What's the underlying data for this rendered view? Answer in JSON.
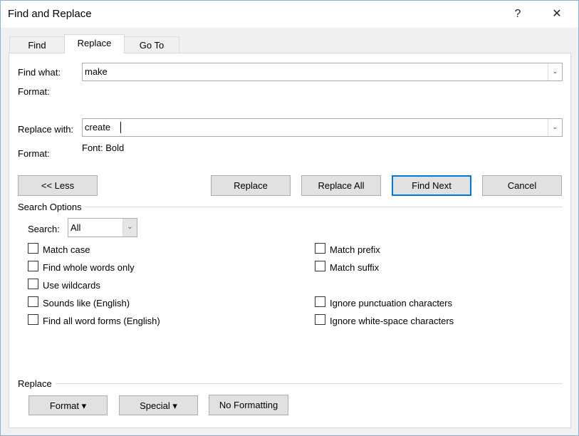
{
  "window": {
    "title": "Find and Replace",
    "help_label": "?",
    "close_label": "✕"
  },
  "tabs": [
    {
      "label": "Find"
    },
    {
      "label": "Replace",
      "active": true
    },
    {
      "label": "Go To"
    }
  ],
  "find": {
    "label": "Find what:",
    "value": "make",
    "format_label": "Format:",
    "format_value": ""
  },
  "replace": {
    "label": "Replace with:",
    "value": "create",
    "format_label": "Format:",
    "format_value": "Font: Bold"
  },
  "buttons": {
    "less": "<< Less",
    "replace": "Replace",
    "replace_all": "Replace All",
    "find_next": "Find Next",
    "cancel": "Cancel"
  },
  "search_options": {
    "heading": "Search Options",
    "search_label": "Search:",
    "search_value": "All",
    "left": [
      {
        "label": "Match case",
        "checked": false
      },
      {
        "label": "Find whole words only",
        "checked": false
      },
      {
        "label": "Use wildcards",
        "checked": false
      },
      {
        "label": "Sounds like (English)",
        "checked": false
      },
      {
        "label": "Find all word forms (English)",
        "checked": false
      }
    ],
    "right": [
      {
        "label": "Match prefix",
        "checked": false
      },
      {
        "label": "Match suffix",
        "checked": false
      },
      {
        "label": "Ignore punctuation characters",
        "checked": false
      },
      {
        "label": "Ignore white-space characters",
        "checked": false
      }
    ]
  },
  "replace_section": {
    "heading": "Replace",
    "format": "Format ▾",
    "special": "Special ▾",
    "no_formatting": "No Formatting"
  },
  "colors": {
    "accent": "#0078d7"
  }
}
